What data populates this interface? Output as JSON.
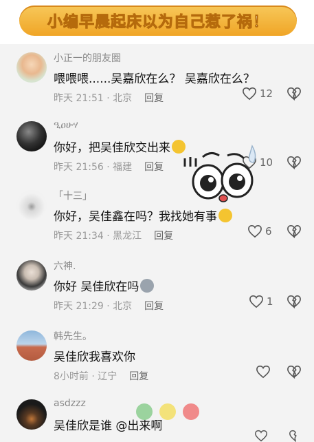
{
  "banner": {
    "title": "小编早晨起床以为自己惹了祸！"
  },
  "comments": [
    {
      "user": "小正一的朋友圈",
      "text": "喂喂喂......吴嘉欣在么？ 吴嘉欣在么？",
      "time": "昨天 21:51 · 北京",
      "reply": "回复",
      "likes": "12"
    },
    {
      "user": "ዒዐሁሃ",
      "text": "你好，把吴佳欣交出来",
      "time": "昨天 21:56 · 福建",
      "reply": "回复",
      "likes": "10"
    },
    {
      "user": "「十三」",
      "text": "你好，吴佳鑫在吗？我找她有事",
      "time": "昨天 21:34 · 黑龙江",
      "reply": "回复",
      "likes": "6"
    },
    {
      "user": "六神.",
      "text": "你好 吴佳欣在吗",
      "time": "昨天 21:29 · 北京",
      "reply": "回复",
      "likes": "1"
    },
    {
      "user": "韩先生。",
      "text": "吴佳欣我喜欢你",
      "time": "8小时前 · 辽宁",
      "reply": "回复",
      "likes": ""
    },
    {
      "user": "asdzzz",
      "text": "吴佳欣是谁 @出来啊",
      "time": "",
      "reply": "",
      "likes": ""
    }
  ],
  "colors": {
    "banner": "#f0a526",
    "dot1": "#9bd39e",
    "dot2": "#f3e27a",
    "dot3": "#f08a8a"
  }
}
